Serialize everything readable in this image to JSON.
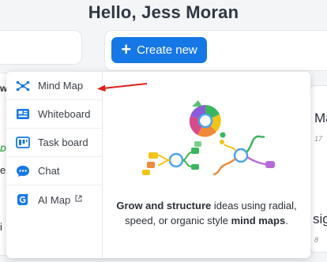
{
  "greeting": "Hello, Jess Moran",
  "create_button": {
    "label": "Create new",
    "icon": "plus-icon"
  },
  "menu": {
    "items": [
      {
        "label": "Mind Map",
        "icon": "mind-map-icon",
        "color": "#1677e6"
      },
      {
        "label": "Whiteboard",
        "icon": "whiteboard-icon",
        "color": "#1677e6"
      },
      {
        "label": "Task board",
        "icon": "task-board-icon",
        "color": "#1677e6"
      },
      {
        "label": "Chat",
        "icon": "chat-icon",
        "color": "#1677e6"
      },
      {
        "label": "AI Map",
        "icon": "ai-map-icon",
        "color": "#1677e6",
        "external": true
      }
    ]
  },
  "preview": {
    "desc_part1": "Grow and structure",
    "desc_part2": " ideas using radial, speed, or organic style ",
    "desc_part3": "mind maps",
    "desc_part4": "."
  },
  "background": {
    "frag_w": "w",
    "frag_d": "D",
    "frag_e": "e",
    "frag_i": "i",
    "frag_ma": "Ma",
    "frag_17": "17",
    "frag_sig": "sig",
    "frag_8": "8"
  },
  "colors": {
    "accent": "#1677e6",
    "arrow": "#e0201a"
  }
}
